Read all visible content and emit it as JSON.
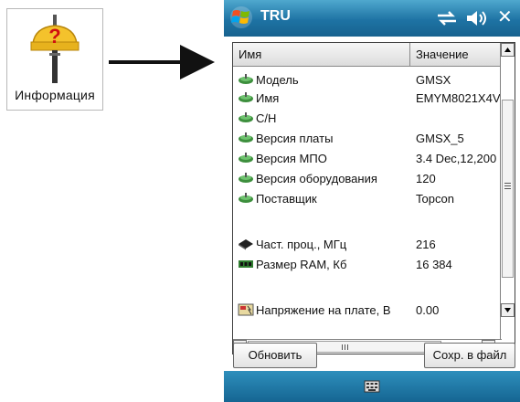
{
  "launcher": {
    "label": "Информация",
    "icon": "information-question-icon"
  },
  "window": {
    "title": "TRU",
    "icons": [
      "start-icon",
      "connectivity-icon",
      "volume-icon",
      "close-icon"
    ],
    "close_glyph": "✕"
  },
  "table": {
    "columns": [
      "Имя",
      "Значение"
    ],
    "rows": [
      {
        "icon": "gps-receiver-icon",
        "name": "Модель",
        "value": "GMSX"
      },
      {
        "icon": "gps-receiver-icon",
        "name": "Имя",
        "value": "EMYM8021X4V"
      },
      {
        "icon": "gps-receiver-icon",
        "name": "С/Н",
        "value": ""
      },
      {
        "icon": "gps-receiver-icon",
        "name": "Версия платы",
        "value": "GMSX_5"
      },
      {
        "icon": "gps-receiver-icon",
        "name": "Версия МПО",
        "value": "3.4 Dec,12,200"
      },
      {
        "icon": "gps-receiver-icon",
        "name": "Версия оборудования",
        "value": "120"
      },
      {
        "icon": "gps-receiver-icon",
        "name": "Поставщик",
        "value": "Topcon"
      },
      {
        "icon": "cpu-chip-icon",
        "name": "Част. проц., МГц",
        "value": "216"
      },
      {
        "icon": "ram-module-icon",
        "name": "Размер RAM, Кб",
        "value": "16 384"
      },
      {
        "icon": "voltage-icon",
        "name": "Напряжение на плате, В",
        "value": "0.00"
      }
    ]
  },
  "buttons": {
    "refresh": "Обновить",
    "save": "Сохр. в файл"
  },
  "colors": {
    "titlebar": "#1e73a4",
    "bottombar": "#156592"
  }
}
